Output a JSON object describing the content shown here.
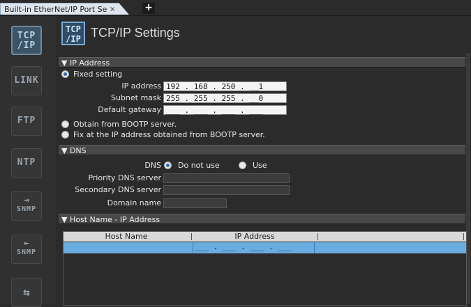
{
  "tabbar": {
    "tab_label": "Built-in EtherNet/IP Port Se",
    "close_glyph": "×",
    "add_glyph": "+"
  },
  "sidebar": {
    "items": [
      {
        "label": "TCP\n/IP",
        "name": "tcpip"
      },
      {
        "label": "LINK",
        "name": "link"
      },
      {
        "label": "FTP",
        "name": "ftp"
      },
      {
        "label": "NTP",
        "name": "ntp"
      },
      {
        "label": "SNMP",
        "name": "snmp"
      },
      {
        "label": "SNMP",
        "name": "snmp-trap"
      },
      {
        "label": "",
        "name": "more"
      }
    ]
  },
  "header": {
    "title": "TCP/IP Settings",
    "icon_line1": "TCP",
    "icon_line2": "/IP"
  },
  "ip_section": {
    "title": "▼ IP Address",
    "fixed_label": "Fixed setting",
    "ip_label": "IP address",
    "ip_value": "192 . 168 . 250 . __1",
    "mask_label": "Subnet mask",
    "mask_value": "255 . 255 . 255 . __0",
    "gw_label": "Default gateway",
    "gw_value": "___ . ___ . ___ . ___",
    "bootp_label": "Obtain from BOOTP server.",
    "bootp_fix_label": "Fix at the IP address obtained from BOOTP server."
  },
  "dns_section": {
    "title": "▼ DNS",
    "dns_label": "DNS",
    "do_not_use": "Do not use",
    "use": "Use",
    "priority_label": "Priority DNS server",
    "secondary_label": "Secondary DNS server",
    "domain_label": "Domain name"
  },
  "host_section": {
    "title": "▼ Host Name - IP Address",
    "col_host": "Host Name",
    "col_ip": "IP Address",
    "row_ip": "___ . ___ . ___ . ___"
  }
}
